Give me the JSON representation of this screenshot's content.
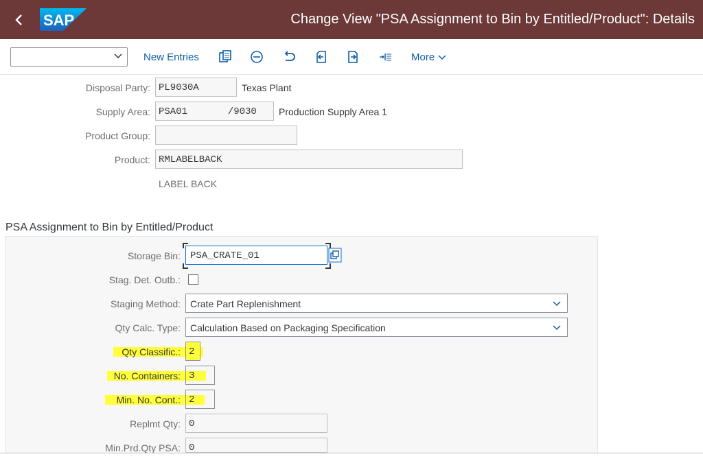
{
  "header": {
    "back_icon": "chevron-left-icon",
    "logo_text": "SAP",
    "title": "Change View \"PSA Assignment to Bin by Entitled/Product\": Details"
  },
  "toolbar": {
    "dropdown_value": "",
    "new_entries_label": "New Entries",
    "icons": [
      "copy-icon",
      "minus-circle-icon",
      "undo-icon",
      "previous-entry-icon",
      "next-entry-icon",
      "expand-icon"
    ],
    "more_label": "More"
  },
  "header_fields": {
    "disposal_party": {
      "label": "Disposal Party:",
      "value": "PL9030A",
      "description": "Texas Plant"
    },
    "supply_area": {
      "label": "Supply Area:",
      "value": "PSA01       /9030",
      "description": "Production Supply Area 1"
    },
    "product_group": {
      "label": "Product Group:",
      "value": ""
    },
    "product": {
      "label": "Product:",
      "value": "RMLABELBACK",
      "description": "LABEL BACK"
    }
  },
  "section": {
    "title": "PSA Assignment to Bin by Entitled/Product",
    "storage_bin": {
      "label": "Storage Bin:",
      "value": "PSA_CRATE_01"
    },
    "stag_det_outb": {
      "label": "Stag. Det. Outb.:",
      "checked": false
    },
    "staging_method": {
      "label": "Staging Method:",
      "value": "Crate Part Replenishment"
    },
    "qty_calc_type": {
      "label": "Qty Calc. Type:",
      "value": "Calculation Based on Packaging Specification"
    },
    "qty_classific": {
      "label": "Qty Classific.:",
      "value": "2"
    },
    "no_containers": {
      "label": "No. Containers:",
      "value": "3"
    },
    "min_no_cont": {
      "label": "Min. No. Cont.:",
      "value": "2"
    },
    "replmt_qty": {
      "label": "Replmt Qty:",
      "value": "0"
    },
    "min_prd_qty_psa": {
      "label": "Min.Prd.Qty PSA:",
      "value": "0"
    }
  },
  "colors": {
    "shell": "#6c3838",
    "link": "#0a5ea8",
    "highlight": "#ffff3b"
  }
}
